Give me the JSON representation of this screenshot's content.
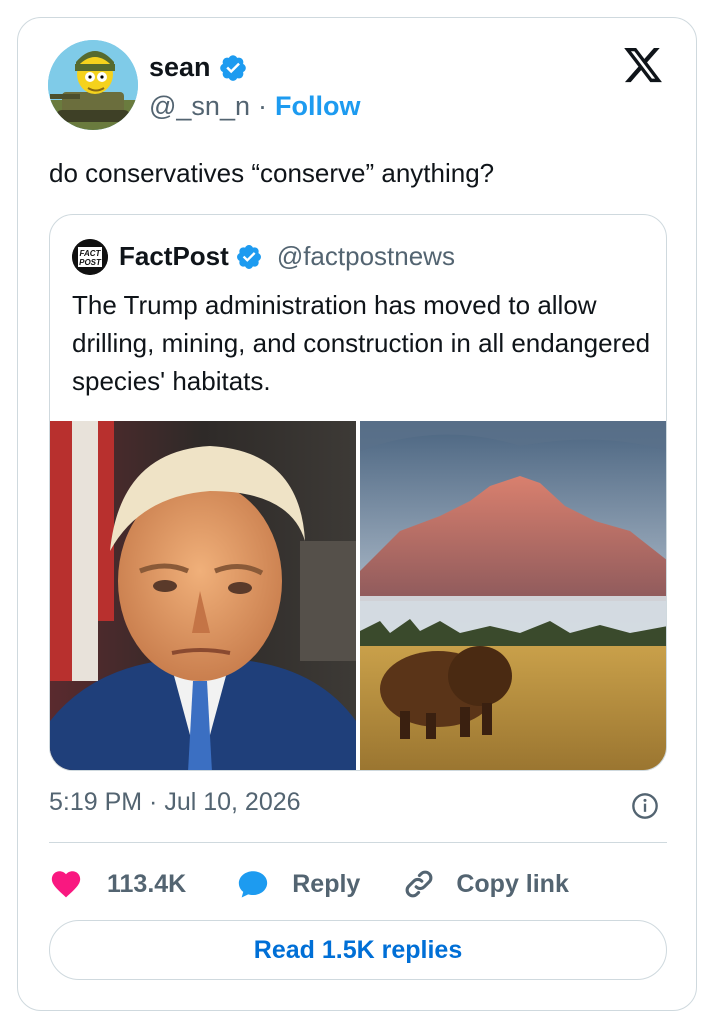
{
  "tweet": {
    "author_name": "sean",
    "author_handle": "@_sn_n",
    "follow_label": "Follow",
    "separator": "·",
    "text": "do conservatives “conserve” anything?",
    "timestamp": "5:19 PM · Jul 10, 2026"
  },
  "quoted": {
    "name": "FactPost",
    "handle": "@factpostnews",
    "text": "The Trump administration has moved to allow drilling, mining, and construction in all endangered species' habitats.",
    "avatar_text_top": "FACT",
    "avatar_text_bottom": "POST"
  },
  "actions": {
    "like_count": "113.4K",
    "reply_label": "Reply",
    "copy_label": "Copy link"
  },
  "read_replies_label": "Read 1.5K replies",
  "icons": {
    "logo": "x-logo-icon",
    "verified": "verified-badge-icon",
    "info": "info-icon",
    "like": "heart-icon",
    "reply": "reply-bubble-icon",
    "copy": "link-icon"
  },
  "colors": {
    "accent": "#1d9bf0",
    "like": "#f91880",
    "secondary_text": "#536471",
    "border": "#cfd9de",
    "button_text": "#006fd6"
  }
}
